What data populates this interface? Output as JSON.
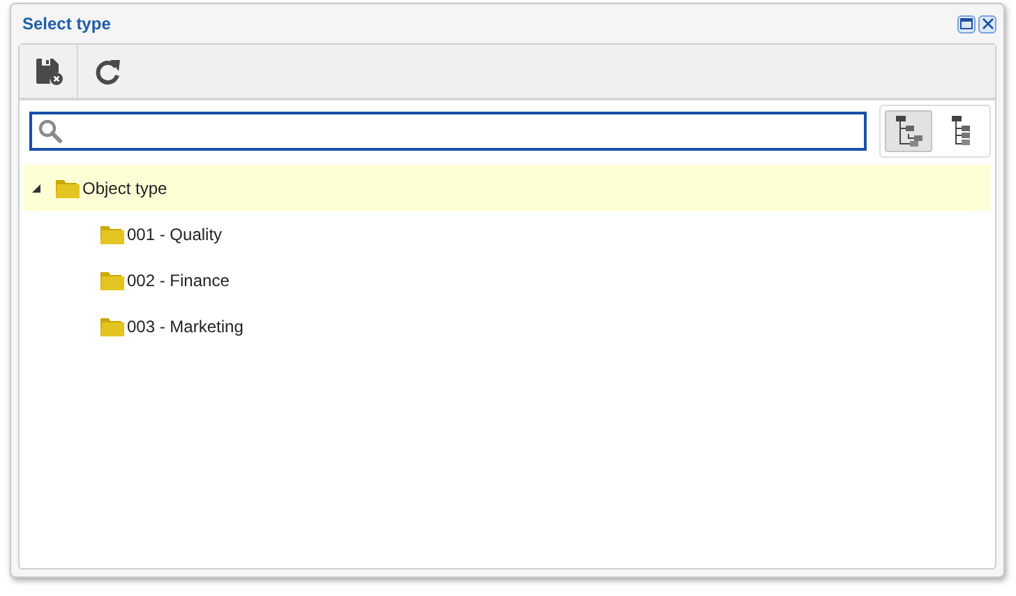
{
  "window": {
    "title": "Select type"
  },
  "toolbar": [
    {
      "kind": "save-cancel"
    },
    {
      "kind": "refresh"
    }
  ],
  "view_modes": [
    {
      "kind": "tree",
      "selected": true
    },
    {
      "kind": "list",
      "selected": false
    }
  ],
  "tree": [
    {
      "label": "Object type",
      "expanded": true,
      "selected": true,
      "children": [
        {
          "label": "001 - Quality",
          "selected": false
        },
        {
          "label": "002 - Finance",
          "selected": false
        },
        {
          "label": "003 - Marketing",
          "selected": false
        }
      ]
    }
  ]
}
